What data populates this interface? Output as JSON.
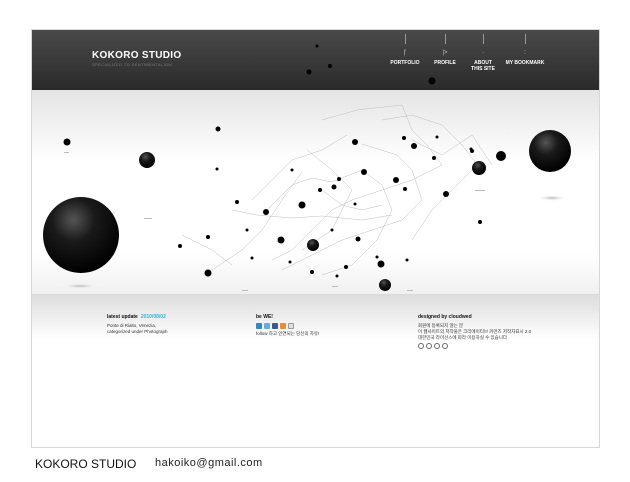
{
  "site": {
    "brand": "KOKORO STUDIO",
    "tagline": "SPECIALIZED TO SENTIMENTALISM"
  },
  "nav": [
    {
      "label": "PORTFOLIO",
      "glyph": "|'"
    },
    {
      "label": "PROFILE",
      "glyph": "|>"
    },
    {
      "label": "ABOUT THIS SITE",
      "glyph": "·"
    },
    {
      "label": "MY BOOKMARK",
      "glyph": ":"
    }
  ],
  "footer": {
    "latest": {
      "title": "latest update",
      "date": "2010/08/02",
      "lines": [
        "Ponte di Rialto, Venezia,",
        "categorized under Photograph"
      ]
    },
    "follow": {
      "title": "be WE!",
      "text": "follow 하고 인연되는 당신의 자유!",
      "icons": [
        "twitter-icon",
        "twitter-icon",
        "facebook-icon",
        "rss-icon",
        "mail-icon"
      ]
    },
    "design": {
      "title": "designed by cloudwed",
      "lines": [
        "회원에 등록되지 않는 분",
        "이 웹사이트의 저작물은 크리에이티브 커먼즈 저작자표시 2.0",
        "대한민국 라이선스에 따라 이용하실 수 있습니다"
      ]
    }
  },
  "caption": {
    "name": "KOKORO STUDIO",
    "email": "hakoiko@gmail.com"
  },
  "colors": {
    "header": "#2f2f2f",
    "accent": "#36b5d6"
  }
}
